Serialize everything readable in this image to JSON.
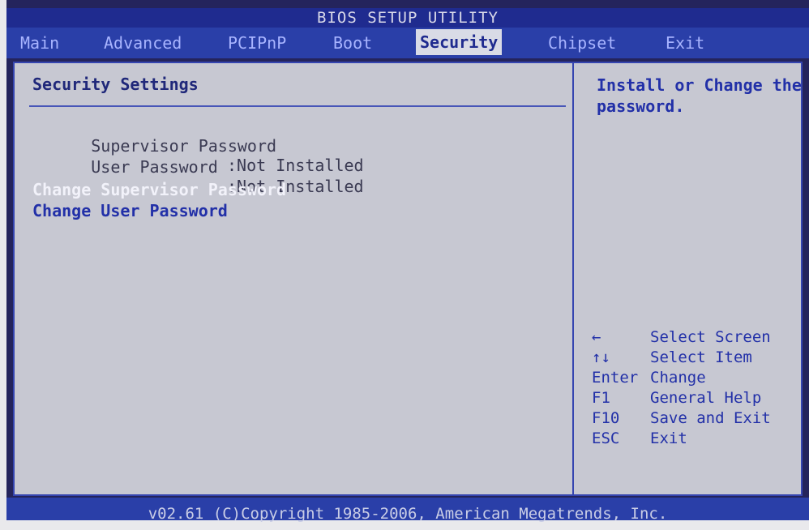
{
  "window": {
    "title": "BIOS SETUP UTILITY"
  },
  "tabs": [
    {
      "label": "Main"
    },
    {
      "label": "Advanced"
    },
    {
      "label": "PCIPnP"
    },
    {
      "label": "Boot"
    },
    {
      "label": "Security"
    },
    {
      "label": "Chipset"
    },
    {
      "label": "Exit"
    }
  ],
  "active_tab": "Security",
  "security": {
    "section_title": "Security Settings",
    "fields": [
      {
        "label": "Supervisor Password",
        "value": ":Not Installed"
      },
      {
        "label": "User Password",
        "value": ":Not Installed"
      }
    ],
    "options": [
      {
        "label": "Change Supervisor Password"
      },
      {
        "label": "Change User Password"
      }
    ]
  },
  "help": {
    "text": "Install or Change the password."
  },
  "keys": [
    {
      "key": "←",
      "action": "Select Screen"
    },
    {
      "key": "↑↓",
      "action": "Select Item"
    },
    {
      "key": "Enter",
      "action": "Change"
    },
    {
      "key": "F1",
      "action": "General Help"
    },
    {
      "key": "F10",
      "action": "Save and Exit"
    },
    {
      "key": "ESC",
      "action": "Exit"
    }
  ],
  "footer": {
    "text": "v02.61 (C)Copyright 1985-2006, American Megatrends, Inc."
  },
  "colors": {
    "accent": "#2a3fa8",
    "panel": "#c7c8d2",
    "highlight": "#f2f2fa"
  }
}
